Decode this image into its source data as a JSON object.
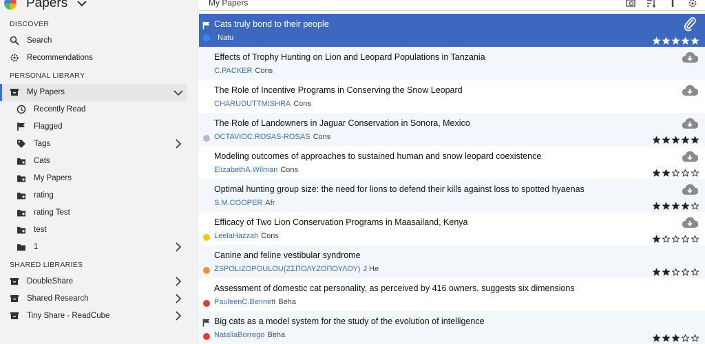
{
  "sidebar": {
    "title": "Papers",
    "sections": {
      "discover": "DISCOVER",
      "personal": "PERSONAL LIBRARY",
      "shared": "SHARED LIBRARIES"
    },
    "discover": [
      {
        "label": "Search",
        "icon": "search-icon"
      },
      {
        "label": "Recommendations",
        "icon": "gear-icon"
      }
    ],
    "personal": [
      {
        "label": "My Papers",
        "icon": "archive-icon",
        "active": true,
        "chevron": "down"
      },
      {
        "label": "Recently Read",
        "icon": "clock-icon"
      },
      {
        "label": "Flagged",
        "icon": "flag-icon"
      },
      {
        "label": "Tags",
        "icon": "tag-icon",
        "chevron": "right"
      },
      {
        "label": "Cats",
        "icon": "folder-icon"
      },
      {
        "label": "My Papers",
        "icon": "folder-icon"
      },
      {
        "label": "rating",
        "icon": "folder-icon"
      },
      {
        "label": "rating Test",
        "icon": "folder-icon"
      },
      {
        "label": "test",
        "icon": "folder-icon"
      },
      {
        "label": "1",
        "icon": "folder-solid-icon",
        "chevron": "right"
      }
    ],
    "shared": [
      {
        "label": "DoubleShare",
        "icon": "archive-icon",
        "chevron": "right"
      },
      {
        "label": "Shared Research",
        "icon": "archive-icon",
        "chevron": "right"
      },
      {
        "label": "Tiny Share - ReadCube",
        "icon": "archive-icon",
        "chevron": "right"
      }
    ]
  },
  "toolbar": {
    "title": "My Papers"
  },
  "papers": [
    {
      "title": "Cats truly bond to their people",
      "authors": "Natu",
      "journal": "",
      "dot": "#2f8cf0",
      "flag": true,
      "rating": 5,
      "status": "attachment",
      "selected": true
    },
    {
      "title": "Effects of Trophy Hunting on Lion and Leopard Populations in Tanzania",
      "authors": "C.PACKER",
      "journal": "Cons",
      "dot": "",
      "flag": false,
      "rating": 0,
      "status": "download"
    },
    {
      "title": "The Role of Incentive Programs in Conserving the Snow Leopard",
      "authors": "CHARUDUTTMISHRA",
      "journal": "Cons",
      "dot": "",
      "flag": false,
      "rating": 0,
      "status": "download"
    },
    {
      "title": "The Role of Landowners in Jaguar Conservation in Sonora, Mexico",
      "authors": "OCTAVIOC.ROSAS-ROSAS",
      "journal": "Cons",
      "dot": "#bdbdbd",
      "flag": false,
      "rating": 5,
      "status": "download"
    },
    {
      "title": "Modeling outcomes of approaches to sustained human and snow leopard coexistence",
      "authors": "ElizabethA.Wilman",
      "journal": "Cons",
      "dot": "",
      "flag": false,
      "rating": 2,
      "status": "download"
    },
    {
      "title": "Optimal hunting group size: the need for lions to defend their kills against loss to spotted hyaenas",
      "authors": "S.M.COOPER",
      "journal": "Afr",
      "dot": "",
      "flag": false,
      "rating": 4,
      "status": "download"
    },
    {
      "title": "Efficacy of Two Lion Conservation Programs in Maasailand, Kenya",
      "authors": "LeelaHazzah",
      "journal": "Cons",
      "dot": "#f5c518",
      "flag": false,
      "rating": 1,
      "status": "download"
    },
    {
      "title": "Canine and feline vestibular syndrome",
      "authors": "ZSPOLIZOPOULOU(ΖΣΠΟΛΥΖΟΠΟΥΛΟΥ)",
      "journal": "J He",
      "dot": "#f0902f",
      "flag": false,
      "rating": 2,
      "status": ""
    },
    {
      "title": "Assessment of domestic cat personality, as perceived by 416 owners, suggests six dimensions",
      "authors": "PauleenC.Bennett",
      "journal": "Beha",
      "dot": "#e53935",
      "flag": false,
      "rating": 0,
      "status": ""
    },
    {
      "title": "Big cats as a model system for the study of the evolution of intelligence",
      "authors": "NataliaBorrego",
      "journal": "Beha",
      "dot": "#e53935",
      "flag": true,
      "rating": 3,
      "status": ""
    }
  ]
}
